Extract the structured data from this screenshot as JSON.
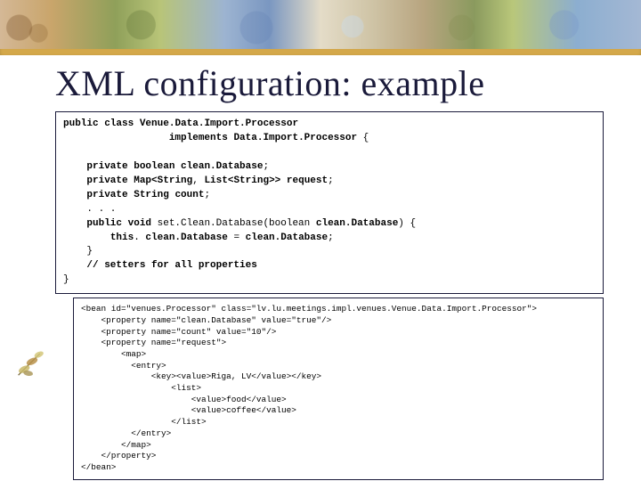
{
  "title": "XML configuration: example",
  "java_code": "public class Venue.Data.Import.Processor\n                  implements Data.Import.Processor {\n\n    private boolean clean.Database;\n    private Map<String, List<String>> request;\n    private String count;\n    . . .\n    public void set.Clean.Database(boolean clean.Database) {\n        this. clean.Database = clean.Database;\n    }\n    // setters for all properties\n}",
  "xml_code": "<bean id=\"venues.Processor\" class=\"lv.lu.meetings.impl.venues.Venue.Data.Import.Processor\">\n    <property name=\"clean.Database\" value=\"true\"/>\n    <property name=\"count\" value=\"10\"/>\n    <property name=\"request\">\n        <map>\n          <entry>\n              <key><value>Riga, LV</value></key>\n                  <list>\n                      <value>food</value>\n                      <value>coffee</value>\n                  </list>\n          </entry>\n        </map>\n    </property>\n</bean>"
}
